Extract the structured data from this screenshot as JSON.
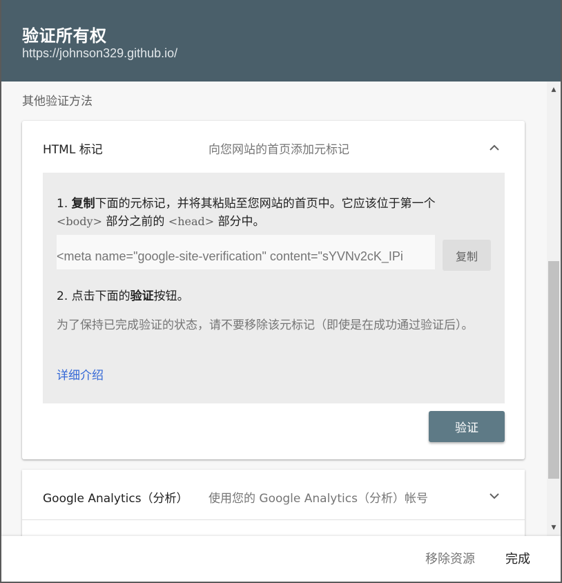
{
  "header": {
    "title": "验证所有权",
    "url": "https://johnson329.github.io/"
  },
  "section_label": "其他验证方法",
  "html_tag_card": {
    "title": "HTML 标记",
    "description": "向您网站的首页添加元标记",
    "step1": {
      "num": "1. ",
      "bold": "复制",
      "text_a": "下面的元标记，并将其粘贴至您网站的首页中。它应该位于第一个",
      "tag_body": "<body>",
      "text_b": "部分之前的",
      "tag_head": "<head>",
      "text_c": "部分中。"
    },
    "meta_tag_value": "<meta name=\"google-site-verification\" content=\"sYVNv2cK_IPi",
    "copy_label": "复制",
    "step2": {
      "prefix": "2. 点击下面的",
      "bold": "验证",
      "suffix": "按钮。"
    },
    "hint": "为了保持已完成验证的状态，请不要移除该元标记（即使是在成功通过验证后）。",
    "learn_more": "详细介绍",
    "verify_label": "验证"
  },
  "analytics_card": {
    "title": "Google Analytics（分析）",
    "description": "使用您的 Google Analytics（分析）帐号"
  },
  "footer": {
    "remove_label": "移除资源",
    "done_label": "完成"
  },
  "colors": {
    "header_bg": "#4a5f6a",
    "verify_button": "#5e7a86",
    "link": "#3367d6"
  },
  "icons": {
    "card_toggle_expanded": "chevron-up-icon",
    "card_toggle_collapsed": "chevron-down-icon"
  }
}
